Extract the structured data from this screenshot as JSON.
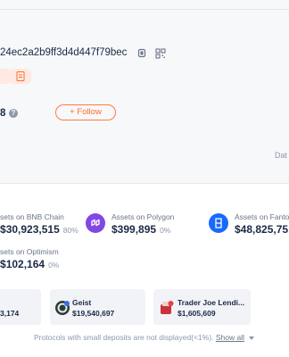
{
  "header": {
    "address": "24ec2a2b9ff3d4d447f79bec",
    "follow_count": "8",
    "follow_button": "+ Follow",
    "data_label": "Dat"
  },
  "chains": [
    {
      "title": "sets on BNB Chain",
      "value": "30,923,515",
      "pct": "80%"
    },
    {
      "title": "Assets on Polygon",
      "value": "$399,895",
      "pct": "0%"
    },
    {
      "title": "Assets on Fanto",
      "value": "$48,825,75",
      "pct": ""
    },
    {
      "title": "sets on Optimism",
      "value": "102,164",
      "pct": "0%"
    }
  ],
  "protocols": [
    {
      "name": "",
      "value": "3,174"
    },
    {
      "name": "Geist",
      "value": "$19,540,697"
    },
    {
      "name": "Trader Joe Lendi...",
      "value": "$1,605,609"
    }
  ],
  "footnote": {
    "text": "Protocols with small deposits are not displayed(<1%).",
    "show_all": "Show all"
  },
  "colors": {
    "accent": "#ff6b2c",
    "polygon": "#8247e5",
    "fantom": "#1969ff"
  }
}
